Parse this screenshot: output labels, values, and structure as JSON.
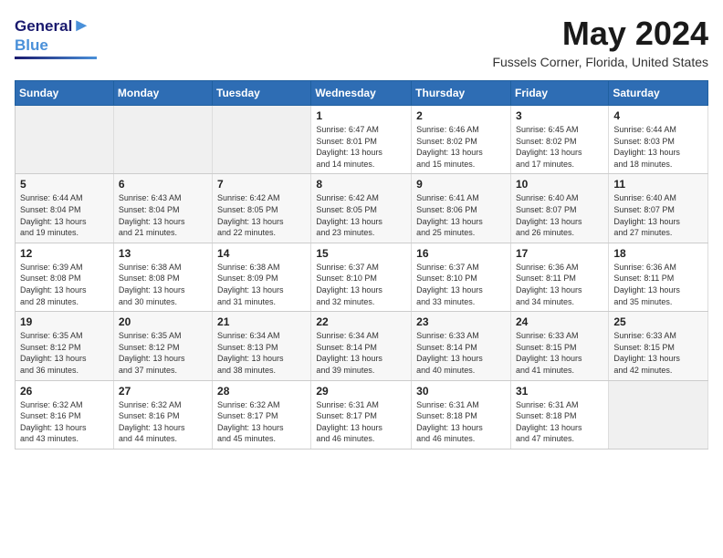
{
  "logo": {
    "line1": "General",
    "line2": "Blue"
  },
  "title": "May 2024",
  "location": "Fussels Corner, Florida, United States",
  "weekdays": [
    "Sunday",
    "Monday",
    "Tuesday",
    "Wednesday",
    "Thursday",
    "Friday",
    "Saturday"
  ],
  "weeks": [
    [
      {
        "day": "",
        "info": ""
      },
      {
        "day": "",
        "info": ""
      },
      {
        "day": "",
        "info": ""
      },
      {
        "day": "1",
        "info": "Sunrise: 6:47 AM\nSunset: 8:01 PM\nDaylight: 13 hours\nand 14 minutes."
      },
      {
        "day": "2",
        "info": "Sunrise: 6:46 AM\nSunset: 8:02 PM\nDaylight: 13 hours\nand 15 minutes."
      },
      {
        "day": "3",
        "info": "Sunrise: 6:45 AM\nSunset: 8:02 PM\nDaylight: 13 hours\nand 17 minutes."
      },
      {
        "day": "4",
        "info": "Sunrise: 6:44 AM\nSunset: 8:03 PM\nDaylight: 13 hours\nand 18 minutes."
      }
    ],
    [
      {
        "day": "5",
        "info": "Sunrise: 6:44 AM\nSunset: 8:04 PM\nDaylight: 13 hours\nand 19 minutes."
      },
      {
        "day": "6",
        "info": "Sunrise: 6:43 AM\nSunset: 8:04 PM\nDaylight: 13 hours\nand 21 minutes."
      },
      {
        "day": "7",
        "info": "Sunrise: 6:42 AM\nSunset: 8:05 PM\nDaylight: 13 hours\nand 22 minutes."
      },
      {
        "day": "8",
        "info": "Sunrise: 6:42 AM\nSunset: 8:05 PM\nDaylight: 13 hours\nand 23 minutes."
      },
      {
        "day": "9",
        "info": "Sunrise: 6:41 AM\nSunset: 8:06 PM\nDaylight: 13 hours\nand 25 minutes."
      },
      {
        "day": "10",
        "info": "Sunrise: 6:40 AM\nSunset: 8:07 PM\nDaylight: 13 hours\nand 26 minutes."
      },
      {
        "day": "11",
        "info": "Sunrise: 6:40 AM\nSunset: 8:07 PM\nDaylight: 13 hours\nand 27 minutes."
      }
    ],
    [
      {
        "day": "12",
        "info": "Sunrise: 6:39 AM\nSunset: 8:08 PM\nDaylight: 13 hours\nand 28 minutes."
      },
      {
        "day": "13",
        "info": "Sunrise: 6:38 AM\nSunset: 8:08 PM\nDaylight: 13 hours\nand 30 minutes."
      },
      {
        "day": "14",
        "info": "Sunrise: 6:38 AM\nSunset: 8:09 PM\nDaylight: 13 hours\nand 31 minutes."
      },
      {
        "day": "15",
        "info": "Sunrise: 6:37 AM\nSunset: 8:10 PM\nDaylight: 13 hours\nand 32 minutes."
      },
      {
        "day": "16",
        "info": "Sunrise: 6:37 AM\nSunset: 8:10 PM\nDaylight: 13 hours\nand 33 minutes."
      },
      {
        "day": "17",
        "info": "Sunrise: 6:36 AM\nSunset: 8:11 PM\nDaylight: 13 hours\nand 34 minutes."
      },
      {
        "day": "18",
        "info": "Sunrise: 6:36 AM\nSunset: 8:11 PM\nDaylight: 13 hours\nand 35 minutes."
      }
    ],
    [
      {
        "day": "19",
        "info": "Sunrise: 6:35 AM\nSunset: 8:12 PM\nDaylight: 13 hours\nand 36 minutes."
      },
      {
        "day": "20",
        "info": "Sunrise: 6:35 AM\nSunset: 8:12 PM\nDaylight: 13 hours\nand 37 minutes."
      },
      {
        "day": "21",
        "info": "Sunrise: 6:34 AM\nSunset: 8:13 PM\nDaylight: 13 hours\nand 38 minutes."
      },
      {
        "day": "22",
        "info": "Sunrise: 6:34 AM\nSunset: 8:14 PM\nDaylight: 13 hours\nand 39 minutes."
      },
      {
        "day": "23",
        "info": "Sunrise: 6:33 AM\nSunset: 8:14 PM\nDaylight: 13 hours\nand 40 minutes."
      },
      {
        "day": "24",
        "info": "Sunrise: 6:33 AM\nSunset: 8:15 PM\nDaylight: 13 hours\nand 41 minutes."
      },
      {
        "day": "25",
        "info": "Sunrise: 6:33 AM\nSunset: 8:15 PM\nDaylight: 13 hours\nand 42 minutes."
      }
    ],
    [
      {
        "day": "26",
        "info": "Sunrise: 6:32 AM\nSunset: 8:16 PM\nDaylight: 13 hours\nand 43 minutes."
      },
      {
        "day": "27",
        "info": "Sunrise: 6:32 AM\nSunset: 8:16 PM\nDaylight: 13 hours\nand 44 minutes."
      },
      {
        "day": "28",
        "info": "Sunrise: 6:32 AM\nSunset: 8:17 PM\nDaylight: 13 hours\nand 45 minutes."
      },
      {
        "day": "29",
        "info": "Sunrise: 6:31 AM\nSunset: 8:17 PM\nDaylight: 13 hours\nand 46 minutes."
      },
      {
        "day": "30",
        "info": "Sunrise: 6:31 AM\nSunset: 8:18 PM\nDaylight: 13 hours\nand 46 minutes."
      },
      {
        "day": "31",
        "info": "Sunrise: 6:31 AM\nSunset: 8:18 PM\nDaylight: 13 hours\nand 47 minutes."
      },
      {
        "day": "",
        "info": ""
      }
    ]
  ]
}
